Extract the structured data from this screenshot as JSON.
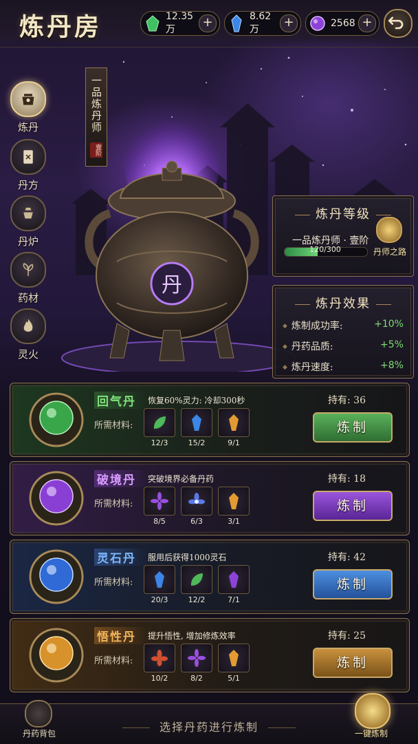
{
  "header": {
    "title": "炼丹房",
    "resources": [
      {
        "icon": "green-jade-icon",
        "value": "12.35万",
        "color": "#4fd06a"
      },
      {
        "icon": "blue-crystal-icon",
        "value": "8.62万",
        "color": "#4d9cf0"
      },
      {
        "icon": "purple-orb-icon",
        "value": "2568",
        "color": "#a85cf0"
      }
    ],
    "back_icon": "back-arrow-icon"
  },
  "nav": [
    {
      "label": "炼丹",
      "icon": "cauldron-icon",
      "active": true
    },
    {
      "label": "丹方",
      "icon": "recipe-card-icon",
      "active": false
    },
    {
      "label": "丹炉",
      "icon": "furnace-icon",
      "active": false
    },
    {
      "label": "药材",
      "icon": "herb-icon",
      "active": false
    },
    {
      "label": "灵火",
      "icon": "flame-icon",
      "active": false
    }
  ],
  "rank_banner": {
    "text": "一品炼丹师",
    "seal": "壹阶"
  },
  "cauldron": {
    "glyph": "丹"
  },
  "level_panel": {
    "title": "炼丹等级",
    "rank": "一品炼丹师 · 壹阶",
    "progress_text": "120/300",
    "progress_fraction": 0.4,
    "road_label": "丹师之路",
    "road_icon": "alchemist-road-icon"
  },
  "effect_panel": {
    "title": "炼丹效果",
    "rows": [
      {
        "label": "炼制成功率:",
        "value": "+10%"
      },
      {
        "label": "丹药品质:",
        "value": "+5%"
      },
      {
        "label": "炼丹速度:",
        "value": "+8%"
      }
    ]
  },
  "materials_label": "所需材料:",
  "pills": [
    {
      "name": "回气丹",
      "desc": "恢复60%灵力: 冷却300秒",
      "own": "持有: 36",
      "button": "炼制",
      "theme": "#3f9a45",
      "materials": [
        {
          "icon": "green-leaf-icon",
          "count": "12/3"
        },
        {
          "icon": "blue-crystal-icon",
          "count": "15/2"
        },
        {
          "icon": "amber-crystal-icon",
          "count": "9/1"
        }
      ]
    },
    {
      "name": "破境丹",
      "desc": "突破境界必备丹药",
      "own": "持有: 18",
      "button": "炼制",
      "theme": "#8a3fd4",
      "materials": [
        {
          "icon": "purple-flower-icon",
          "count": "8/5"
        },
        {
          "icon": "blue-lotus-icon",
          "count": "6/3"
        },
        {
          "icon": "amber-crystal-icon",
          "count": "3/1"
        }
      ]
    },
    {
      "name": "灵石丹",
      "desc": "服用后获得1000灵石",
      "own": "持有: 42",
      "button": "炼制",
      "theme": "#3a7ad0",
      "materials": [
        {
          "icon": "blue-crystal-icon",
          "count": "20/3"
        },
        {
          "icon": "green-leaf-icon",
          "count": "12/2"
        },
        {
          "icon": "purple-crystal-icon",
          "count": "7/1"
        }
      ]
    },
    {
      "name": "悟性丹",
      "desc": "提升悟性, 增加修炼效率",
      "own": "持有: 25",
      "button": "炼制",
      "theme": "#c9892a",
      "materials": [
        {
          "icon": "red-flower-icon",
          "count": "10/2"
        },
        {
          "icon": "purple-flower-icon",
          "count": "8/2"
        },
        {
          "icon": "amber-crystal-icon",
          "count": "5/1"
        }
      ]
    }
  ],
  "footer": {
    "bag_label": "丹药背包",
    "bag_icon": "pill-bag-icon",
    "hint": "选择丹药进行炼制",
    "one_click_label": "一键炼制",
    "one_click_icon": "one-click-refine-icon"
  }
}
